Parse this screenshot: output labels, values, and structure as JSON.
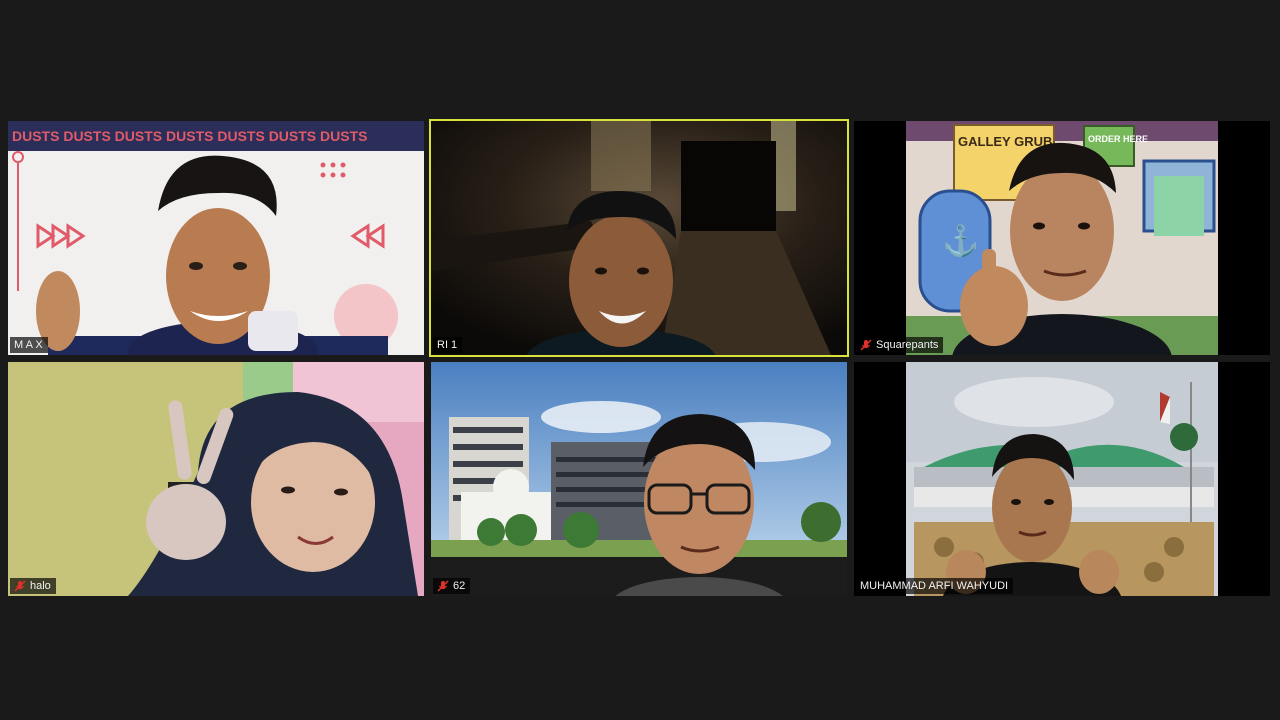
{
  "meeting": {
    "layout": "gallery",
    "participants": [
      {
        "name": "M A X",
        "muted": false,
        "active_speaker": false,
        "background": "dusts-banner"
      },
      {
        "name": "RI 1",
        "muted": false,
        "active_speaker": true,
        "background": "dark-corridor"
      },
      {
        "name": "Squarepants",
        "muted": true,
        "active_speaker": false,
        "background": "krusty-krab-cartoon"
      },
      {
        "name": "halo",
        "muted": true,
        "active_speaker": false,
        "background": "room-wall"
      },
      {
        "name": "62",
        "muted": true,
        "active_speaker": false,
        "background": "campus-building"
      },
      {
        "name": "MUHAMMAD ARFI WAHYUDI",
        "muted": false,
        "active_speaker": false,
        "background": "parliament-building"
      }
    ]
  },
  "tile_text": {
    "dusts_banner": "DUSTS DUSTS DUSTS DUSTS DUSTS DUSTS DUSTS",
    "galley_sign": "GALLEY GRUB",
    "order_sign": "ORDER HERE"
  },
  "colors": {
    "active_border": "#d8e23a",
    "muted_icon": "#e0302c",
    "background": "#1a1a1a"
  }
}
